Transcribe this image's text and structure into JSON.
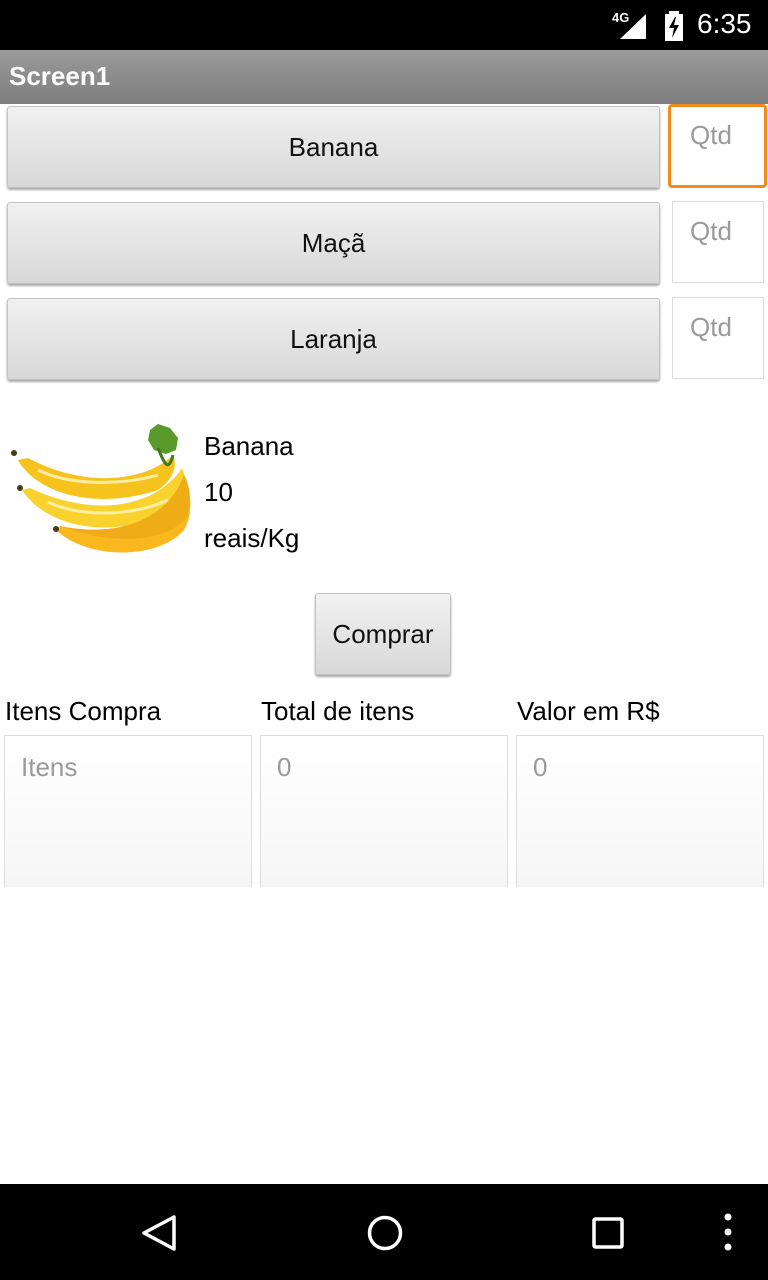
{
  "status_bar": {
    "network": "4G",
    "time": "6:35",
    "icons": [
      "signal-icon",
      "battery-charging-icon"
    ]
  },
  "app": {
    "title": "Screen1"
  },
  "fruits": [
    {
      "label": "Banana",
      "qty_placeholder": "Qtd"
    },
    {
      "label": "Maçã",
      "qty_placeholder": "Qtd"
    },
    {
      "label": "Laranja",
      "qty_placeholder": "Qtd"
    }
  ],
  "product": {
    "name": "Banana",
    "price": "10",
    "unit": "reais/Kg",
    "image": "banana-bunch-image"
  },
  "buy_button": "Comprar",
  "summary": {
    "items_label": "Itens Compra",
    "items_placeholder": "Itens",
    "total_label": "Total de itens",
    "total_value": "0",
    "value_label": "Valor em R$",
    "value_value": "0"
  },
  "nav": {
    "icons": [
      "back-icon",
      "home-icon",
      "recent-apps-icon",
      "overflow-menu-icon"
    ]
  },
  "colors": {
    "focus_accent": "#f28a1c",
    "title_bar": "#8c8c8c"
  }
}
